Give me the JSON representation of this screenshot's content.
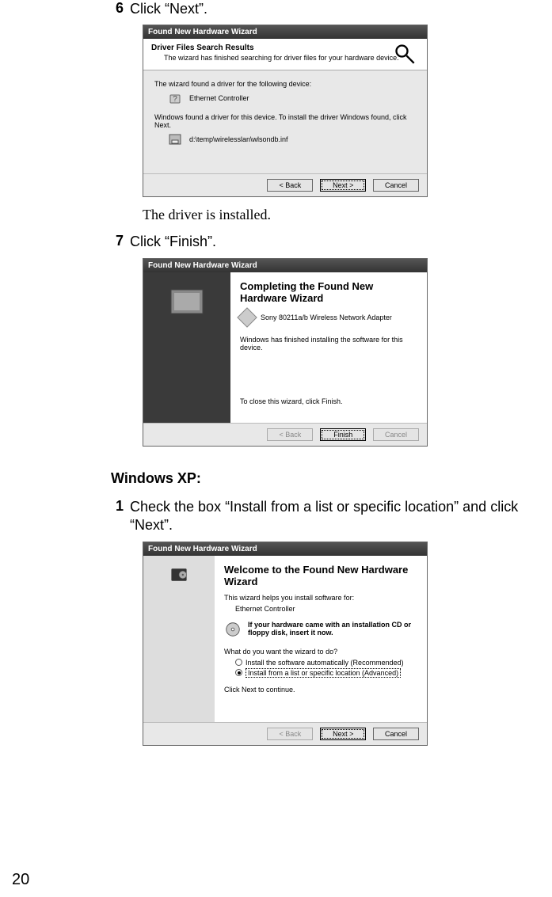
{
  "steps": {
    "s6": {
      "num": "6",
      "text": "Click “Next”."
    },
    "s7": {
      "num": "7",
      "text": "Click “Finish”."
    },
    "xp1": {
      "num": "1",
      "text": "Check the box “Install from a list or specific location” and click “Next”."
    }
  },
  "result_text": "The driver is installed.",
  "section_xp": "Windows XP:",
  "dialog1": {
    "title": "Found New Hardware Wizard",
    "heading": "Driver Files Search Results",
    "sub": "The wizard has finished searching for driver files for your hardware device.",
    "found_line": "The wizard found a driver for the following device:",
    "device": "Ethernet Controller",
    "install_line": "Windows found a driver for this device. To install the driver Windows found, click Next.",
    "path": "d:\\temp\\wirelesslan\\wlsondb.inf",
    "btn_back": "< Back",
    "btn_next": "Next >",
    "btn_cancel": "Cancel"
  },
  "dialog2": {
    "title": "Found New Hardware Wizard",
    "heading": "Completing the Found New Hardware Wizard",
    "device": "Sony 80211a/b Wireless Network Adapter",
    "done_line": "Windows has finished installing the software for this device.",
    "close_line": "To close this wizard, click Finish.",
    "btn_back": "< Back",
    "btn_finish": "Finish",
    "btn_cancel": "Cancel"
  },
  "dialog3": {
    "title": "Found New Hardware Wizard",
    "heading": "Welcome to the Found New Hardware Wizard",
    "help_line": "This wizard helps you install software for:",
    "device": "Ethernet Controller",
    "cd_bold": "If your hardware came with an installation CD or floppy disk, insert it now.",
    "prompt": "What do you want the wizard to do?",
    "opt1": "Install the software automatically (Recommended)",
    "opt2": "Install from a list or specific location (Advanced)",
    "continue": "Click Next to continue.",
    "btn_back": "< Back",
    "btn_next": "Next >",
    "btn_cancel": "Cancel"
  },
  "page_number": "20"
}
